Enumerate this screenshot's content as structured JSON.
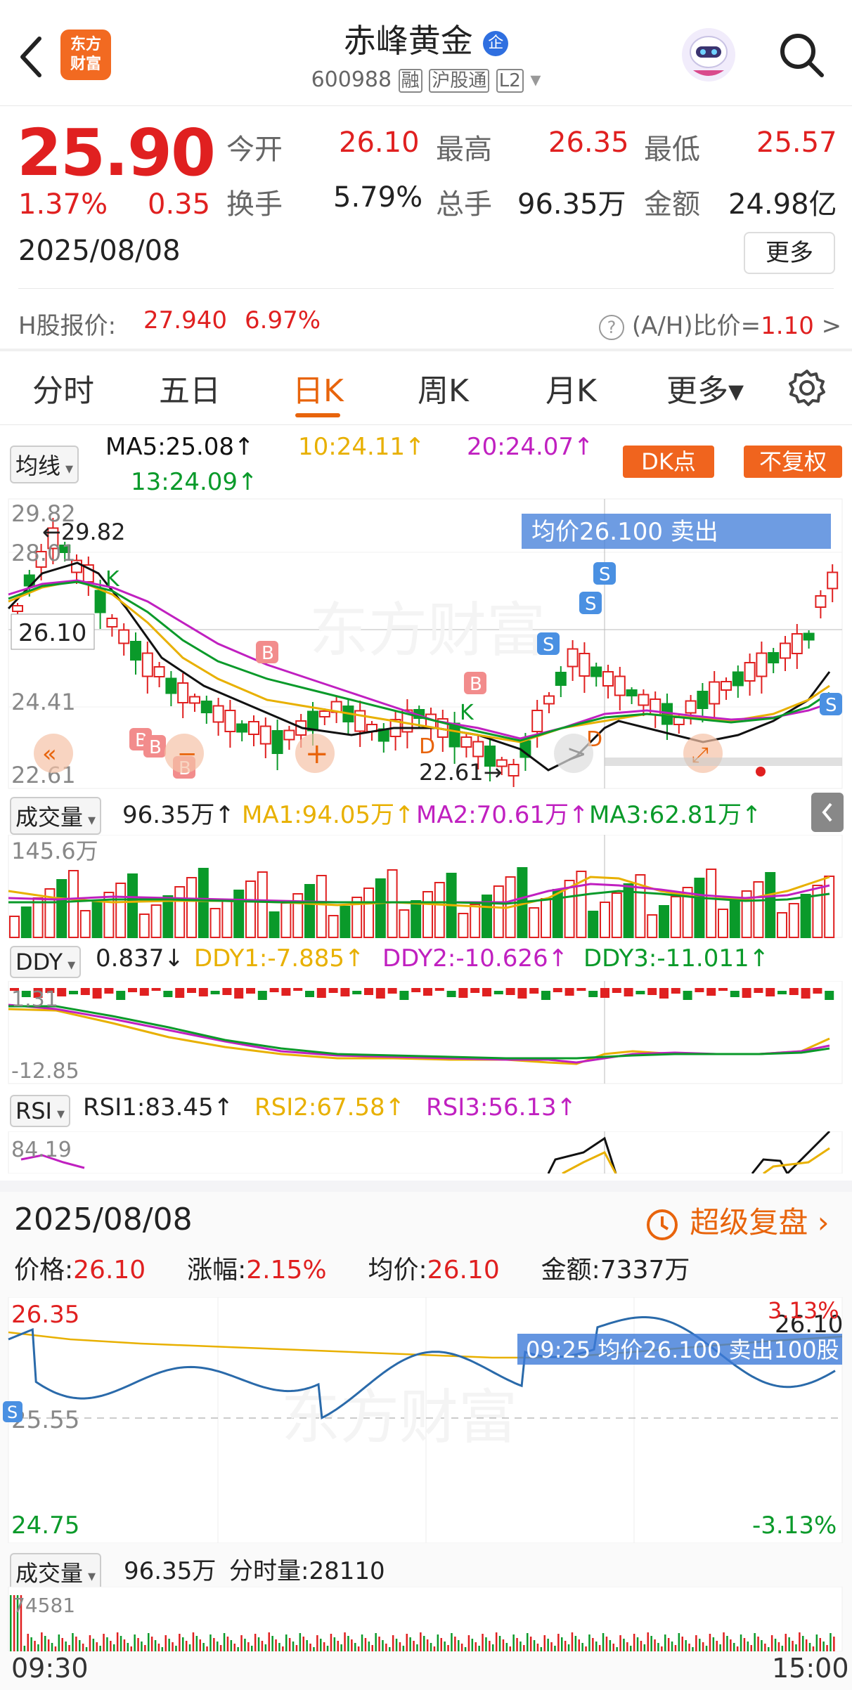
{
  "header": {
    "back_icon": "chevron-left-icon",
    "logo_text_1": "东方",
    "logo_text_2": "财富",
    "title": "赤峰黄金",
    "title_badge": "企",
    "code": "600988",
    "tag_rong": "融",
    "tag_hgt": "沪股通",
    "tag_level": "L2",
    "avatar_icon": "robot-assistant-icon",
    "search_icon": "search-icon"
  },
  "quote": {
    "price": "25.90",
    "change_pct": "1.37%",
    "change_abs": "0.35",
    "date": "2025/08/08",
    "open_label": "今开",
    "open": "26.10",
    "high_label": "最高",
    "high": "26.35",
    "low_label": "最低",
    "low": "25.57",
    "turnover_label": "换手",
    "turnover": "5.79%",
    "volume_label": "总手",
    "volume": "96.35万",
    "amount_label": "金额",
    "amount": "24.98亿",
    "more_label": "更多",
    "h_label": "H股报价:",
    "h_price": "27.940",
    "h_pct": "6.97%",
    "ah_label": "(A/H)比价=",
    "ah_value": "1.10",
    "ah_arrow": ">"
  },
  "tabs": [
    {
      "label": "分时"
    },
    {
      "label": "五日"
    },
    {
      "label": "日K"
    },
    {
      "label": "周K"
    },
    {
      "label": "月K"
    },
    {
      "label": "更多▾"
    }
  ],
  "ma": {
    "selector": "均线",
    "ma5": "MA5:25.08↑",
    "ma10": "10:24.11↑",
    "ma20": "20:24.07↑",
    "ma13": "13:24.09↑",
    "dk_btn": "DK点",
    "fq_btn": "不复权"
  },
  "kchart": {
    "ticks": [
      "29.82",
      "28.01",
      "26.10",
      "24.41",
      "22.61"
    ],
    "max_label": "←29.82",
    "min_label": "22.61→",
    "tooltip": "均价26.100  卖出",
    "price_box": "26.10",
    "markers": [
      "K",
      "K",
      "D",
      "D"
    ]
  },
  "volume": {
    "selector": "成交量",
    "value": "96.35万↑",
    "ma1": "MA1:94.05万↑",
    "ma2": "MA2:70.61万↑",
    "ma3": "MA3:62.81万↑",
    "max": "145.6万"
  },
  "ddy": {
    "selector": "DDY",
    "value": "0.837↓",
    "ddy1": "DDY1:-7.885↑",
    "ddy2": "DDY2:-10.626↑",
    "ddy3": "DDY3:-11.011↑",
    "top": "1.31",
    "bottom": "-12.85"
  },
  "rsi": {
    "selector": "RSI",
    "rsi1": "RSI1:83.45↑",
    "rsi2": "RSI2:67.58↑",
    "rsi3": "RSI3:56.13↑",
    "top": "84.19"
  },
  "intraday": {
    "date": "2025/08/08",
    "replay": "超级复盘",
    "price_label": "价格:",
    "price": "26.10",
    "change_label": "涨幅:",
    "change": "2.15%",
    "avg_label": "均价:",
    "avg": "26.10",
    "amount_label": "金额:",
    "amount": "7337万",
    "y_top": "26.35",
    "y_mid": "25.55",
    "y_bottom": "24.75",
    "pct_top": "3.13%",
    "pct_bottom": "-3.13%",
    "price_tag": "26.10",
    "tooltip": "09:25  均价26.100  卖出100股",
    "vol_selector": "成交量",
    "vol_value": "96.35万",
    "vol_minute_label": "分时量:",
    "vol_minute": "28110",
    "vol_max": "74581",
    "t_start": "09:30",
    "t_end": "15:00"
  },
  "colors": {
    "up": "#e02020",
    "down": "#0a9a2a",
    "accent": "#e8640c",
    "ma5": "#111111",
    "ma10": "#e8b000",
    "ma20": "#c020c0",
    "ma13": "#0a9a2a"
  }
}
